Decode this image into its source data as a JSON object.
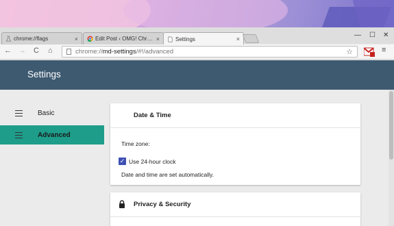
{
  "tabs": [
    {
      "title": "chrome://flags",
      "close": "×",
      "favicon": "flask-icon"
    },
    {
      "title": "Edit Post ‹ OMG! Chrome",
      "close": "×",
      "favicon": "chrome-icon"
    },
    {
      "title": "Settings",
      "close": "×",
      "favicon": "document-icon"
    }
  ],
  "window_controls": {
    "minimize": "—",
    "maximize": "☐",
    "close": "✕"
  },
  "toolbar": {
    "back": "←",
    "forward": "→",
    "reload": "C",
    "home": "⌂",
    "url_scheme": "chrome://",
    "url_host": "md-settings",
    "url_path": "/#!/advanced",
    "bookmark_star": "☆",
    "menu": "≡"
  },
  "header": {
    "title": "Settings"
  },
  "sidebar": {
    "items": [
      {
        "label": "Basic",
        "active": false
      },
      {
        "label": "Advanced",
        "active": true
      }
    ]
  },
  "sections": {
    "datetime": {
      "title": "Date & Time",
      "timezone_label": "Time zone:",
      "use_24h_label": "Use 24-hour clock",
      "use_24h_checked": true,
      "auto_note": "Date and time are set automatically."
    },
    "privacy": {
      "title": "Privacy & Security"
    }
  },
  "colors": {
    "header": "#3e5a71",
    "active_nav": "#1e9d8b",
    "checkbox": "#3f51b5"
  }
}
